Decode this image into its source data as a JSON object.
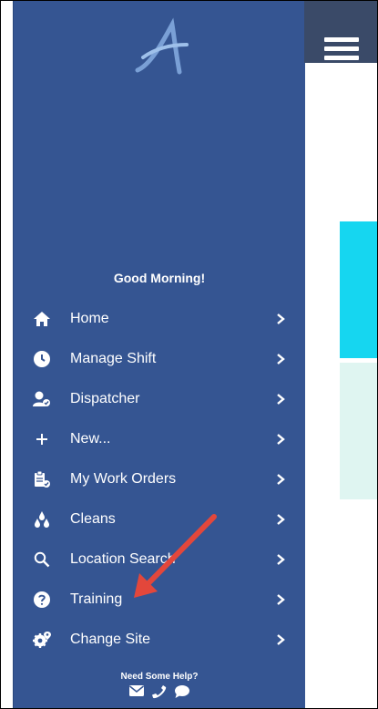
{
  "greeting": "Good Morning!",
  "menu": [
    {
      "label": "Home",
      "icon": "home-icon"
    },
    {
      "label": "Manage Shift",
      "icon": "clock-icon"
    },
    {
      "label": "Dispatcher",
      "icon": "dispatcher-icon"
    },
    {
      "label": "New...",
      "icon": "plus-icon"
    },
    {
      "label": "My Work Orders",
      "icon": "clipboard-icon"
    },
    {
      "label": "Cleans",
      "icon": "drops-icon"
    },
    {
      "label": "Location Search",
      "icon": "search-icon"
    },
    {
      "label": "Training",
      "icon": "question-icon"
    },
    {
      "label": "Change Site",
      "icon": "location-cog-icon"
    }
  ],
  "help": {
    "label": "Need Some Help?",
    "icons": [
      "mail-icon",
      "phone-icon",
      "chat-icon"
    ]
  },
  "colors": {
    "sidebar": "#355592",
    "topbar": "#3a4a68",
    "cyan": "#16d6f0",
    "mint": "#dff5f1",
    "arrow": "#e3473b"
  }
}
